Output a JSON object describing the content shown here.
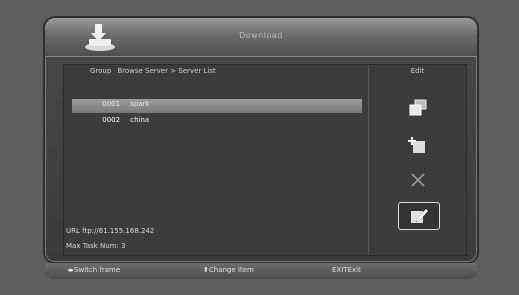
{
  "window": {
    "title": "Download"
  },
  "breadcrumb": {
    "group_label": "Group",
    "path": "Browse Server > Server List"
  },
  "servers": [
    {
      "num": "0001",
      "name": "spark",
      "selected": false
    },
    {
      "num": "0002",
      "name": "china",
      "selected": true
    }
  ],
  "info": {
    "url": "URL ftp://61.155.168.242",
    "max_task": "Max Task Num: 3"
  },
  "actions": {
    "title": "Edit",
    "items": [
      {
        "name": "copy-icon"
      },
      {
        "name": "add-icon"
      },
      {
        "name": "delete-icon"
      },
      {
        "name": "edit-icon",
        "selected": true
      }
    ]
  },
  "footer": {
    "switch_frame": "Switch frame",
    "change_item": "Change Item",
    "exit_key": "EXIT",
    "exit_label": "Exit"
  }
}
